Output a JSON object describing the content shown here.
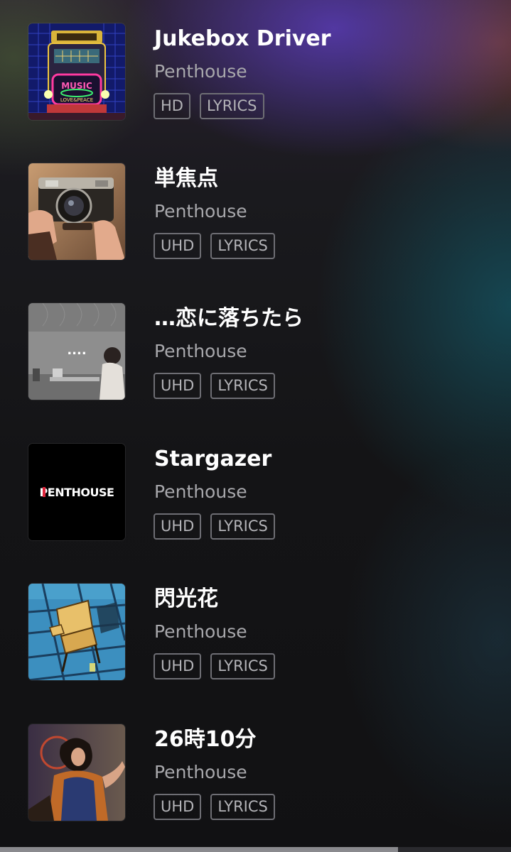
{
  "tracks": [
    {
      "title": "Jukebox Driver",
      "artist": "Penthouse",
      "badges": [
        "HD",
        "LYRICS"
      ],
      "artwork": "jukebox-artwork",
      "artwork_text": [
        "MUSIC",
        "LOVE&PEACE"
      ]
    },
    {
      "title": "単焦点",
      "artist": "Penthouse",
      "badges": [
        "UHD",
        "LYRICS"
      ],
      "artwork": "camera-artwork"
    },
    {
      "title": "…恋に落ちたら",
      "artist": "Penthouse",
      "badges": [
        "UHD",
        "LYRICS"
      ],
      "artwork": "room-artwork",
      "artwork_text": [
        "...."
      ]
    },
    {
      "title": "Stargazer",
      "artist": "Penthouse",
      "badges": [
        "UHD",
        "LYRICS"
      ],
      "artwork": "logo-artwork",
      "artwork_text": [
        "PENTHOUSE"
      ]
    },
    {
      "title": "閃光花",
      "artist": "Penthouse",
      "badges": [
        "UHD",
        "LYRICS"
      ],
      "artwork": "chair-artwork"
    },
    {
      "title": "26時10分",
      "artist": "Penthouse",
      "badges": [
        "UHD",
        "LYRICS"
      ],
      "artwork": "singer-artwork"
    }
  ],
  "colors": {
    "title": "#ffffff",
    "artist": "#a8a8ac",
    "badge_border": "#6e6e74",
    "logo_accent": "#e0263c"
  }
}
